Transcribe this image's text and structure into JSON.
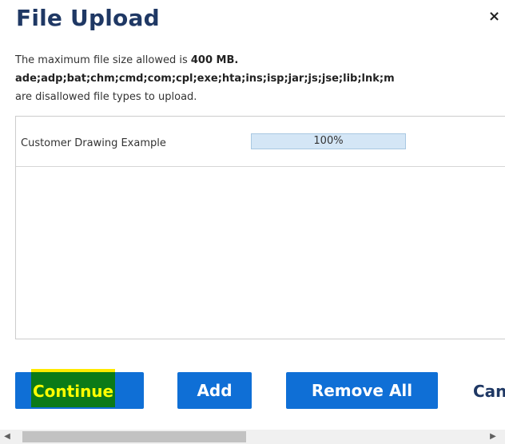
{
  "dialog": {
    "title": "File Upload",
    "close_label": "×"
  },
  "info": {
    "max_size_prefix": "The maximum file size allowed is ",
    "max_size_value": "400 MB.",
    "disallowed_types": "ade;adp;bat;chm;cmd;com;cpl;exe;hta;ins;isp;jar;js;jse;lib;lnk;m",
    "disallowed_suffix": "are disallowed file types to upload."
  },
  "files": [
    {
      "name": "Customer Drawing Example",
      "progress_text": "100%",
      "progress_value": 1.0
    }
  ],
  "buttons": {
    "continue": "Continue",
    "add": "Add",
    "remove_all": "Remove All",
    "cancel": "Can"
  },
  "scrollbar": {
    "left_arrow": "◀",
    "right_arrow": "▶"
  },
  "colors": {
    "title": "#1f3864",
    "button": "#0f6fd6",
    "highlight_bg": "#0b7a18",
    "highlight_text": "#ffff00"
  }
}
